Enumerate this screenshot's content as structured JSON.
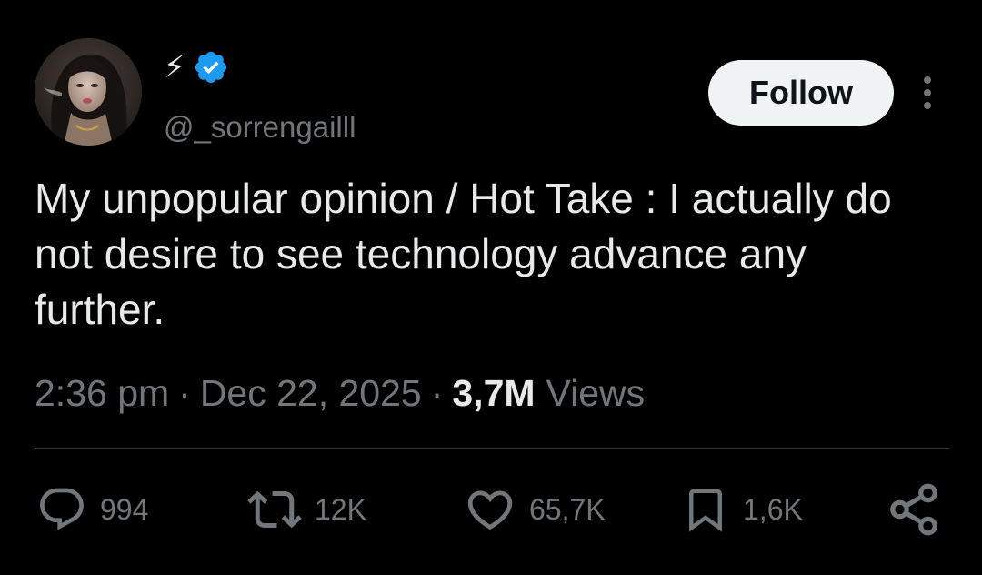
{
  "author": {
    "display_name": "⚡",
    "handle": "@_sorrengailll",
    "verified": true,
    "verified_color": "#1d9bf0"
  },
  "header": {
    "follow_label": "Follow",
    "more_icon": "more-vertical-icon"
  },
  "tweet": {
    "text": "My unpopular opinion / Hot Take : I actually do not desire to see technology advance any further.",
    "time": "2:36 pm",
    "separator": "·",
    "date": "Dec 22, 2025",
    "views_count": "3,7M",
    "views_label": "Views"
  },
  "actions": {
    "replies": "994",
    "reposts": "12K",
    "likes": "65,7K",
    "bookmarks": "1,6K"
  },
  "icons": {
    "reply": "reply-bubble-icon",
    "repost": "repost-arrows-icon",
    "like": "heart-icon",
    "bookmark": "bookmark-icon",
    "share": "share-icon"
  },
  "colors": {
    "background": "#000000",
    "text_primary": "#e7e9ea",
    "text_secondary": "#71767b",
    "follow_bg": "#eff3f4",
    "divider": "#2f3336"
  }
}
